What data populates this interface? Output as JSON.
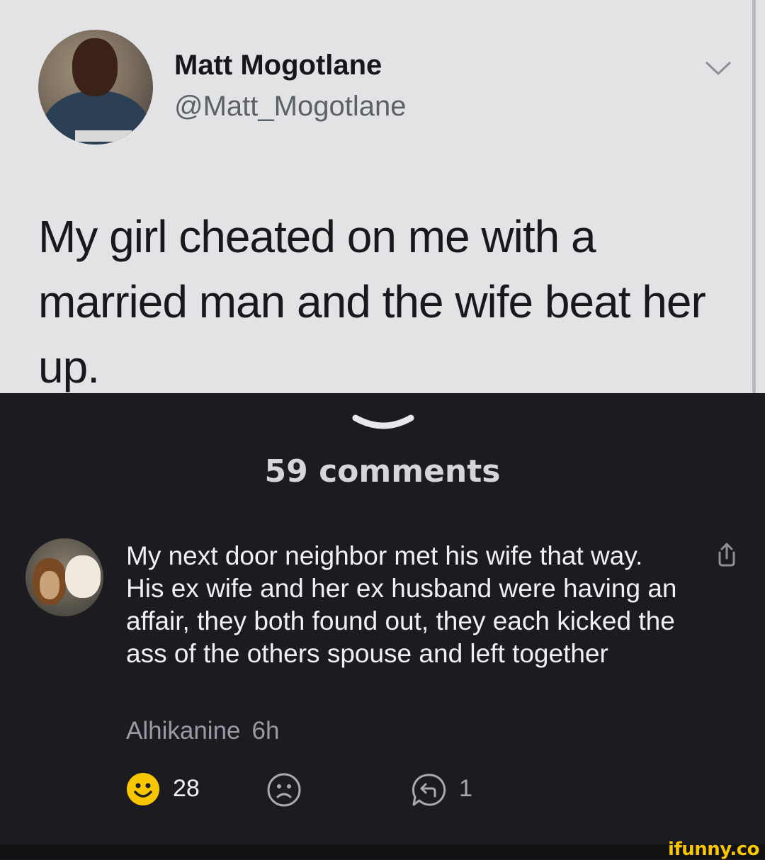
{
  "tweet": {
    "display_name": "Matt Mogotlane",
    "handle": "@Matt_Mogotlane",
    "text": "My girl cheated on me with a married man and the wife beat her up."
  },
  "comments": {
    "count_label": "59 comments",
    "items": [
      {
        "text": "My next door neighbor met his wife that way. His ex wife and her ex husband were having an affair, they both found out, they each kicked the ass of the others spouse and left together",
        "author": "Alhikanine",
        "time": "6h",
        "smiles": "28",
        "replies": "1"
      }
    ]
  },
  "colors": {
    "smile_yellow": "#f7c600",
    "dark_background": "#1b1b21",
    "tweet_background": "#e3e3e5"
  },
  "icons": [
    "chevron-down-icon",
    "drag-handle-icon",
    "share-icon",
    "smile-icon",
    "unsmile-icon",
    "reply-icon"
  ],
  "watermark": "ifunny.co"
}
